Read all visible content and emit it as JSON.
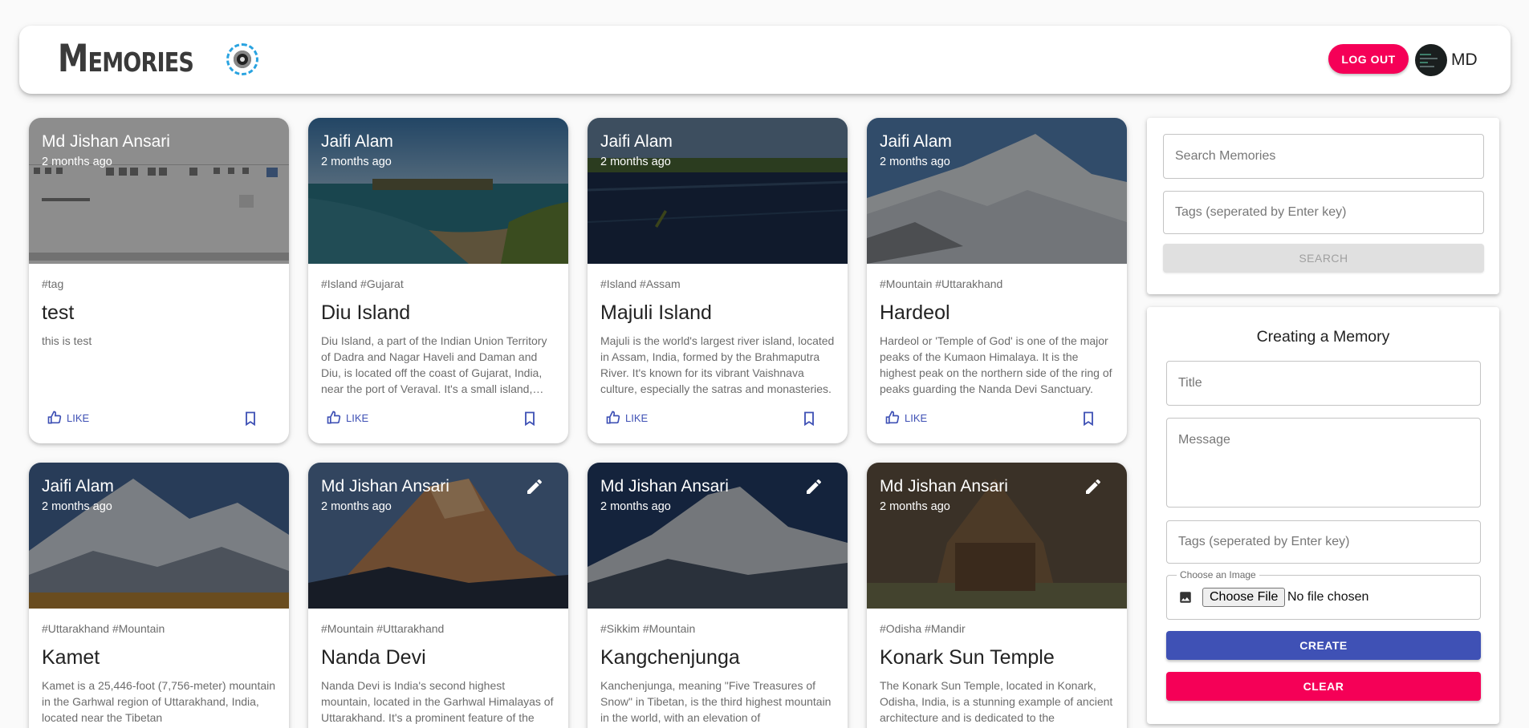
{
  "header": {
    "brand": "Memories",
    "logo_icon": "camera-lens-icon",
    "logout_label": "LOG OUT",
    "user_name": "MD",
    "accent_color": "#f50057"
  },
  "posts": [
    {
      "creator": "Md Jishan Ansari",
      "time": "2 months ago",
      "tags": "#tag",
      "title": "test",
      "message": "this is test",
      "like_label": "LIKE",
      "editable": false
    },
    {
      "creator": "Jaifi Alam",
      "time": "2 months ago",
      "tags": "#Island #Gujarat",
      "title": "Diu Island",
      "message": "Diu Island, a part of the Indian Union Territory of Dadra and Nagar Haveli and Daman and Diu, is located off the coast of Gujarat, India, near the port of Veraval. It's a small island, known for its beaches and Portuguese heritage.",
      "like_label": "LIKE",
      "editable": false
    },
    {
      "creator": "Jaifi Alam",
      "time": "2 months ago",
      "tags": "#Island #Assam",
      "title": "Majuli Island",
      "message": "Majuli is the world's largest river island, located in Assam, India, formed by the Brahmaputra River. It's known for its vibrant Vaishnava culture, especially the satras and monasteries.",
      "like_label": "LIKE",
      "editable": false
    },
    {
      "creator": "Jaifi Alam",
      "time": "2 months ago",
      "tags": "#Mountain #Uttarakhand",
      "title": "Hardeol",
      "message": "Hardeol or 'Temple of God' is one of the major peaks of the Kumaon Himalaya. It is the highest peak on the northern side of the ring of peaks guarding the Nanda Devi Sanctuary.",
      "like_label": "LIKE",
      "editable": false
    },
    {
      "creator": "Jaifi Alam",
      "time": "2 months ago",
      "tags": "#Uttarakhand #Mountain",
      "title": "Kamet",
      "message": "Kamet is a 25,446-foot (7,756-meter) mountain in the Garhwal region of Uttarakhand, India, located near the Tibetan",
      "like_label": "LIKE",
      "editable": false
    },
    {
      "creator": "Md Jishan Ansari",
      "time": "2 months ago",
      "tags": "#Mountain #Uttarakhand",
      "title": "Nanda Devi",
      "message": "Nanda Devi is India's second highest mountain, located in the Garhwal Himalayas of Uttarakhand. It's a prominent feature of the",
      "like_label": "LIKE",
      "editable": true
    },
    {
      "creator": "Md Jishan Ansari",
      "time": "2 months ago",
      "tags": "#Sikkim #Mountain",
      "title": "Kangchenjunga",
      "message": "Kanchenjunga, meaning \"Five Treasures of Snow\" in Tibetan, is the third highest mountain in the world, with an elevation of",
      "like_label": "LIKE",
      "editable": true
    },
    {
      "creator": "Md Jishan Ansari",
      "time": "2 months ago",
      "tags": "#Odisha #Mandir",
      "title": "Konark Sun Temple",
      "message": "The Konark Sun Temple, located in Konark, Odisha, India, is a stunning example of ancient architecture and is dedicated to the",
      "like_label": "LIKE",
      "editable": true
    }
  ],
  "search": {
    "search_placeholder": "Search Memories",
    "tags_placeholder": "Tags (seperated by Enter key)",
    "button_label": "SEARCH"
  },
  "form": {
    "heading": "Creating a Memory",
    "title_placeholder": "Title",
    "message_placeholder": "Message",
    "tags_placeholder": "Tags (seperated by Enter key)",
    "image_legend": "Choose an Image",
    "choose_file_label": "Choose File",
    "no_file_text": "No file chosen",
    "create_label": "CREATE",
    "clear_label": "CLEAR"
  },
  "colors": {
    "primary": "#3f51b5",
    "secondary": "#f50057"
  }
}
